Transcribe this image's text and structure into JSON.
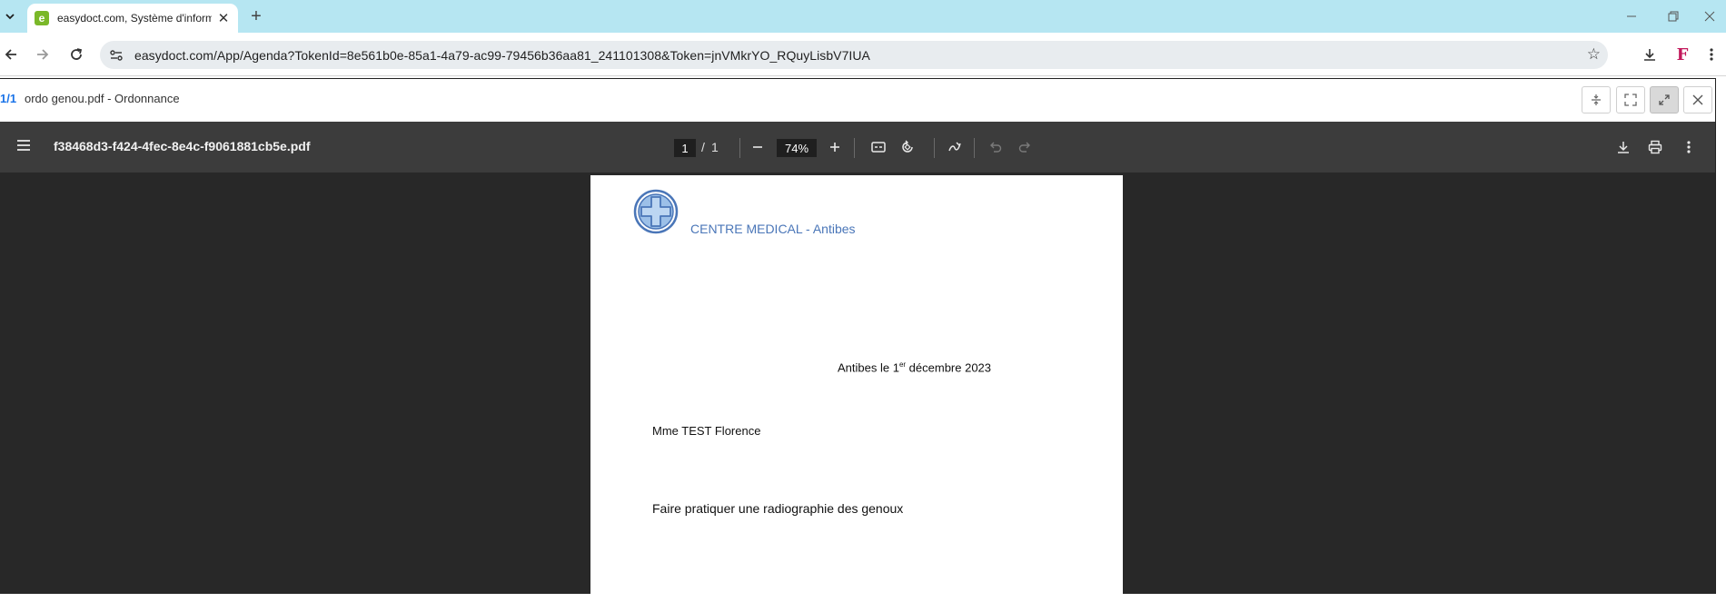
{
  "browser": {
    "tab_title": "easydoct.com, Système d'informa",
    "tab_favicon_letter": "e",
    "url": "easydoct.com/App/Agenda?TokenId=8e561b0e-85a1-4a79-ac99-79456b36aa81_241101308&Token=jnVMkrYO_RQuyLisbV7IUA",
    "colors": {
      "tabstrip": "#b6e6f2",
      "favicon": "#7ab829",
      "extension": "#c2185b"
    }
  },
  "viewer": {
    "doc_count": "1/1",
    "doc_title": "ordo genou.pdf - Ordonnance"
  },
  "pdf": {
    "filename": "f38468d3-f424-4fec-8e4c-f9061881cb5e.pdf",
    "current_page": "1",
    "page_separator": "/",
    "total_pages": "1",
    "zoom": "74%"
  },
  "document": {
    "center_name": "CENTRE MEDICAL - Antibes",
    "date_prefix": "Antibes le 1",
    "date_superscript": "er",
    "date_suffix": " décembre 2023",
    "patient": "Mme TEST Florence",
    "prescription": "Faire pratiquer une radiographie des genoux",
    "logo_color": "#4a76b8"
  }
}
